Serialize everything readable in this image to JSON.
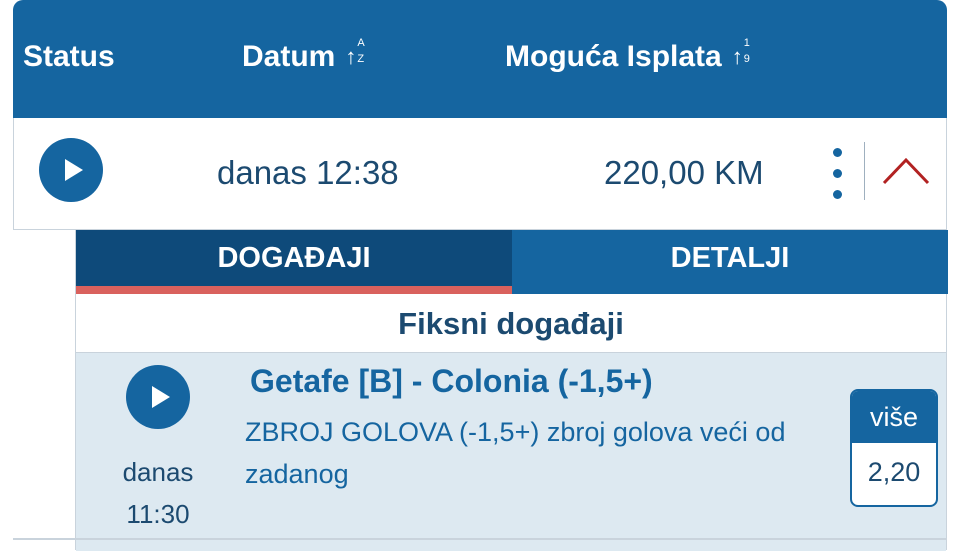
{
  "header": {
    "status_label": "Status",
    "date_label": "Datum",
    "date_sort_icon": "sort-alpha-icon",
    "payout_label": "Moguća Isplata",
    "payout_sort_icon": "sort-numeric-icon"
  },
  "ticket": {
    "status_icon": "play-icon",
    "date": "danas 12:38",
    "payout": "220,00 KM",
    "menu_icon": "kebab-menu-icon",
    "collapse_icon": "chevron-up-icon"
  },
  "tabs": [
    {
      "label": "DOGAĐAJI",
      "active": true
    },
    {
      "label": "DETALJI",
      "active": false
    }
  ],
  "events_section": {
    "title": "Fiksni događaji",
    "events": [
      {
        "status_icon": "play-icon",
        "time_day": "danas",
        "time_clock": "11:30",
        "match": "Getafe [B] - Colonia (-1,5+)",
        "description": "ZBROJ GOLOVA (-1,5+) zbroj golova veći od zadanog",
        "odd_label": "više",
        "odd_value": "2,20"
      }
    ]
  },
  "colors": {
    "primary": "#1565a0",
    "dark_primary": "#0e4a7a",
    "accent_red": "#d9615d",
    "event_bg": "#dde9f1",
    "chevron": "#b22222"
  }
}
